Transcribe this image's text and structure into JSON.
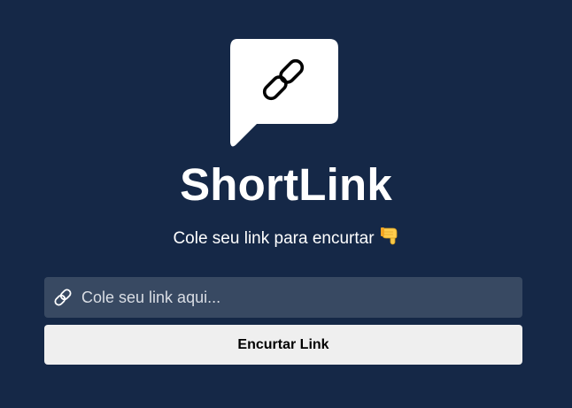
{
  "app": {
    "logo_icon": "chain-link-speech-bubble-icon",
    "title": "ShortLink",
    "subtitle": "Cole seu link para encurtar",
    "subtitle_icon": "pointing-down-hand-emoji"
  },
  "form": {
    "input_icon": "link-icon",
    "input_value": "",
    "input_placeholder": "Cole seu link aqui...",
    "submit_label": "Encurtar Link"
  },
  "colors": {
    "background": "#152847",
    "input_background": "#384962",
    "button_background": "#efefef",
    "text": "#ffffff"
  }
}
